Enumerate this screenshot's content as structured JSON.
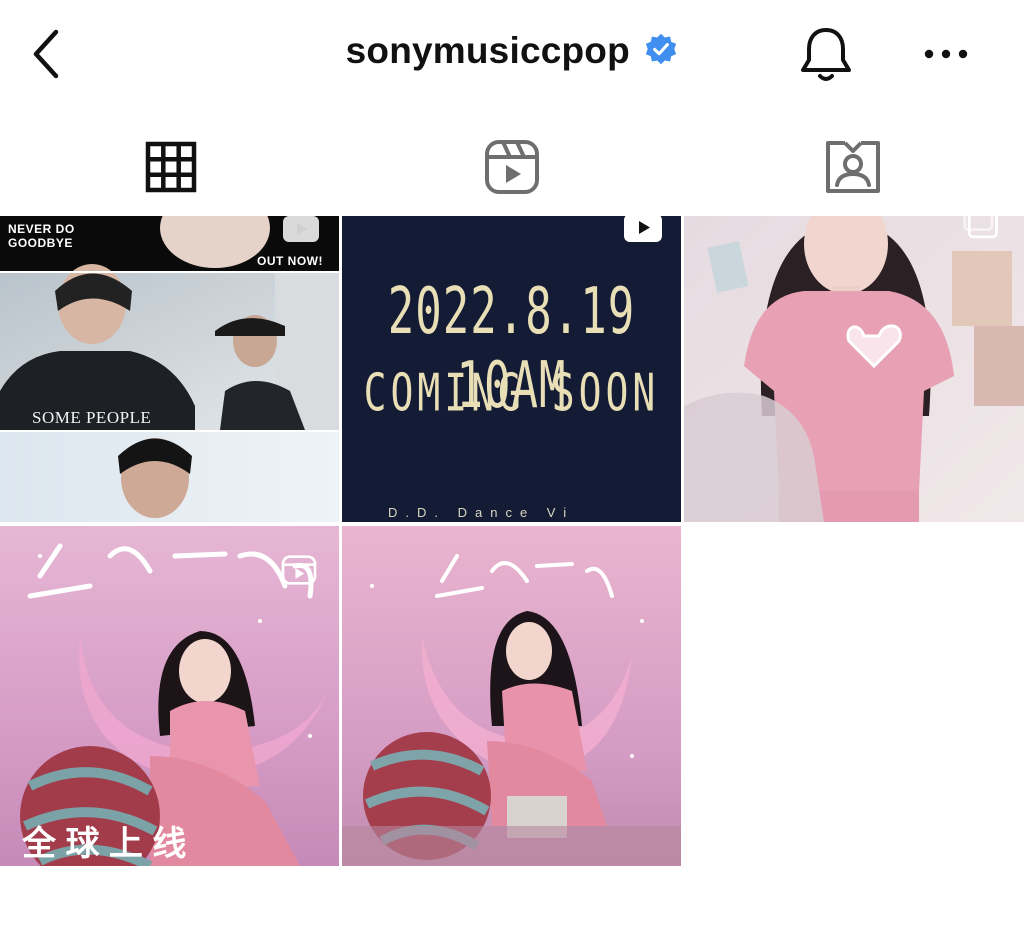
{
  "header": {
    "username": "sonymusiccpop",
    "icons": {
      "back": "chevron-left-icon",
      "verified": "verified-badge-icon",
      "bell": "bell-icon",
      "more": "more-horizontal-icon"
    },
    "verified_color": "#3897f0"
  },
  "tabs": [
    {
      "name": "posts",
      "icon": "grid-icon",
      "active": true
    },
    {
      "name": "reels",
      "icon": "reels-icon",
      "active": false
    },
    {
      "name": "tagged",
      "icon": "tagged-person-icon",
      "active": false
    }
  ],
  "posts": [
    {
      "kind": "reel",
      "lines": [
        "NEVER DO",
        "GOODBYE"
      ],
      "badge_text": "OUT NOW!",
      "shirt_text": "SOME PEOPLE"
    },
    {
      "kind": "reel",
      "line1": "2022.8.19 10AM",
      "line2": "COMING SOON",
      "footer": "D.D.    Dance Vi"
    },
    {
      "kind": "carousel"
    },
    {
      "kind": "reel",
      "title_text": "愛呀愛呀",
      "bottom_text": "全   球   上   线"
    },
    {
      "kind": "image",
      "title_text": "愛呀愛呀"
    }
  ],
  "colors": {
    "post2_bg": "#141c35",
    "post2_text": "#e9dfb6",
    "pink_bg": "#e8b6d0"
  }
}
